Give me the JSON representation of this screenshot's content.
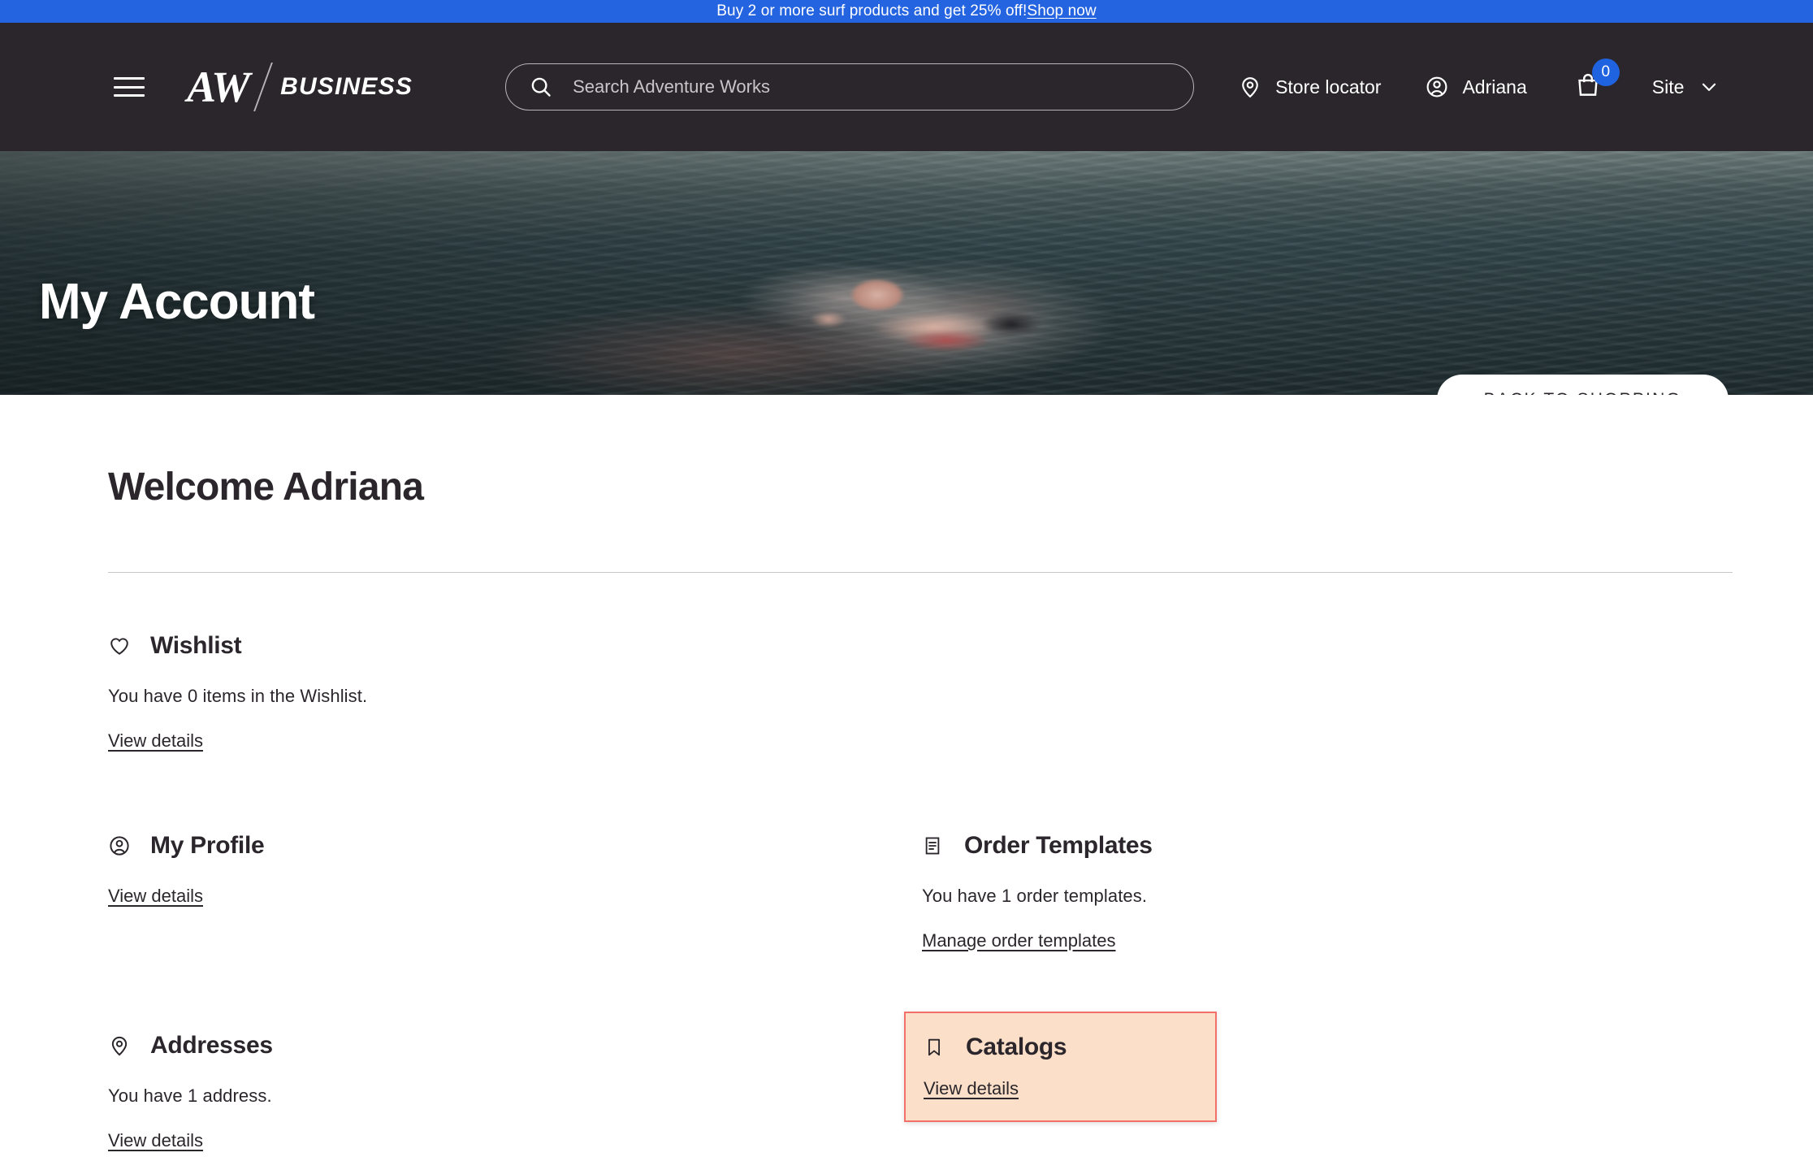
{
  "promo": {
    "text": "Buy 2 or more surf products and get 25% off! ",
    "link_label": "Shop now",
    "background_color": "#2464e0"
  },
  "header": {
    "menu_icon": "hamburger-menu-icon",
    "logo": {
      "primary": "AW",
      "secondary": "BUSINESS"
    },
    "search": {
      "placeholder": "Search Adventure Works",
      "value": "",
      "icon": "search-icon"
    },
    "store_locator": {
      "label": "Store locator",
      "icon": "location-pin-icon"
    },
    "account": {
      "label": "Adriana",
      "icon": "user-circle-icon"
    },
    "cart": {
      "count": "0",
      "icon": "shopping-bag-icon",
      "badge_color": "#1f63e0"
    },
    "site_selector": {
      "label": "Site",
      "icon": "chevron-down-icon"
    },
    "background_color": "#2b262b"
  },
  "hero": {
    "title": "My Account",
    "back_button_label": "BACK TO SHOPPING",
    "image_alt": "open-water-swimmer-photo"
  },
  "main": {
    "welcome_title": "Welcome Adriana",
    "tiles": [
      {
        "id": "wishlist",
        "icon": "heart-icon",
        "title": "Wishlist",
        "description": "You have 0 items in the Wishlist.",
        "link_label": "View details",
        "highlighted": false
      },
      {
        "id": "my-profile",
        "icon": "user-circle-icon",
        "title": "My Profile",
        "description": "",
        "link_label": "View details",
        "highlighted": false
      },
      {
        "id": "order-templates",
        "icon": "document-list-icon",
        "title": "Order Templates",
        "description": "You have 1 order templates.",
        "link_label": "Manage order templates",
        "highlighted": false
      },
      {
        "id": "addresses",
        "icon": "location-pin-icon",
        "title": "Addresses",
        "description": "You have 1 address.",
        "link_label": "View details",
        "highlighted": false
      },
      {
        "id": "catalogs",
        "icon": "bookmark-icon",
        "title": "Catalogs",
        "description": "",
        "link_label": "View details",
        "highlighted": true,
        "highlight_background": "#fbdfc8",
        "highlight_border": "#f2706a"
      }
    ]
  }
}
